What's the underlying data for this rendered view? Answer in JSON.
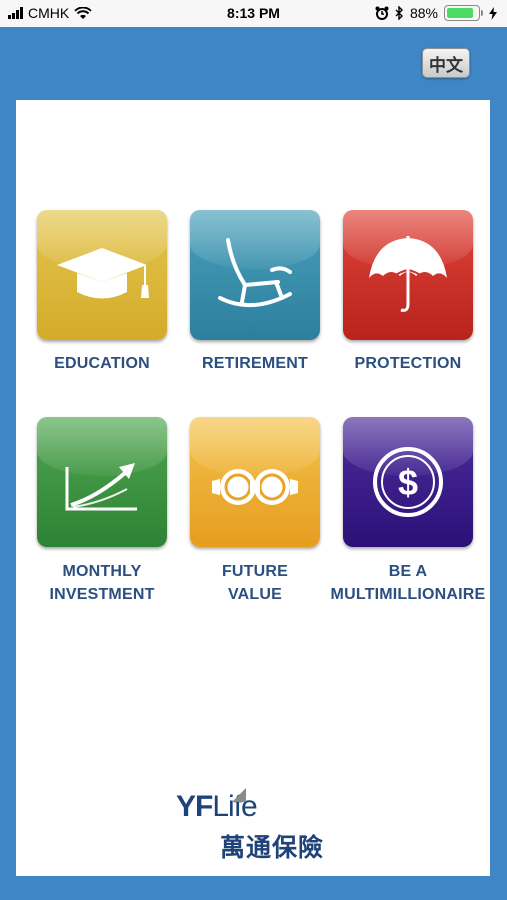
{
  "status_bar": {
    "carrier": "CMHK",
    "time": "8:13 PM",
    "battery_percent": "88%",
    "battery_level": 0.88
  },
  "language_button": {
    "label": "中文"
  },
  "tiles": [
    {
      "label_line1": "EDUCATION",
      "label_line2": "",
      "icon": "graduation-cap-icon",
      "color": "#d9b334"
    },
    {
      "label_line1": "RETIREMENT",
      "label_line2": "",
      "icon": "rocking-chair-icon",
      "color": "#3a8fad"
    },
    {
      "label_line1": "PROTECTION",
      "label_line2": "",
      "icon": "umbrella-icon",
      "color": "#cf2f27"
    },
    {
      "label_line1": "MONTHLY",
      "label_line2": "INVESTMENT",
      "icon": "growth-chart-icon",
      "color": "#3e9642"
    },
    {
      "label_line1": "FUTURE",
      "label_line2": "VALUE",
      "icon": "binoculars-icon",
      "color": "#eeae33"
    },
    {
      "label_line1": "BE A",
      "label_line2": "MULTIMILLIONAIRE",
      "icon": "dollar-coin-icon",
      "color": "#3a1d8a"
    }
  ],
  "logo": {
    "brand_part1": "YF",
    "brand_part2": "Life",
    "chinese_name": "萬通保險"
  }
}
